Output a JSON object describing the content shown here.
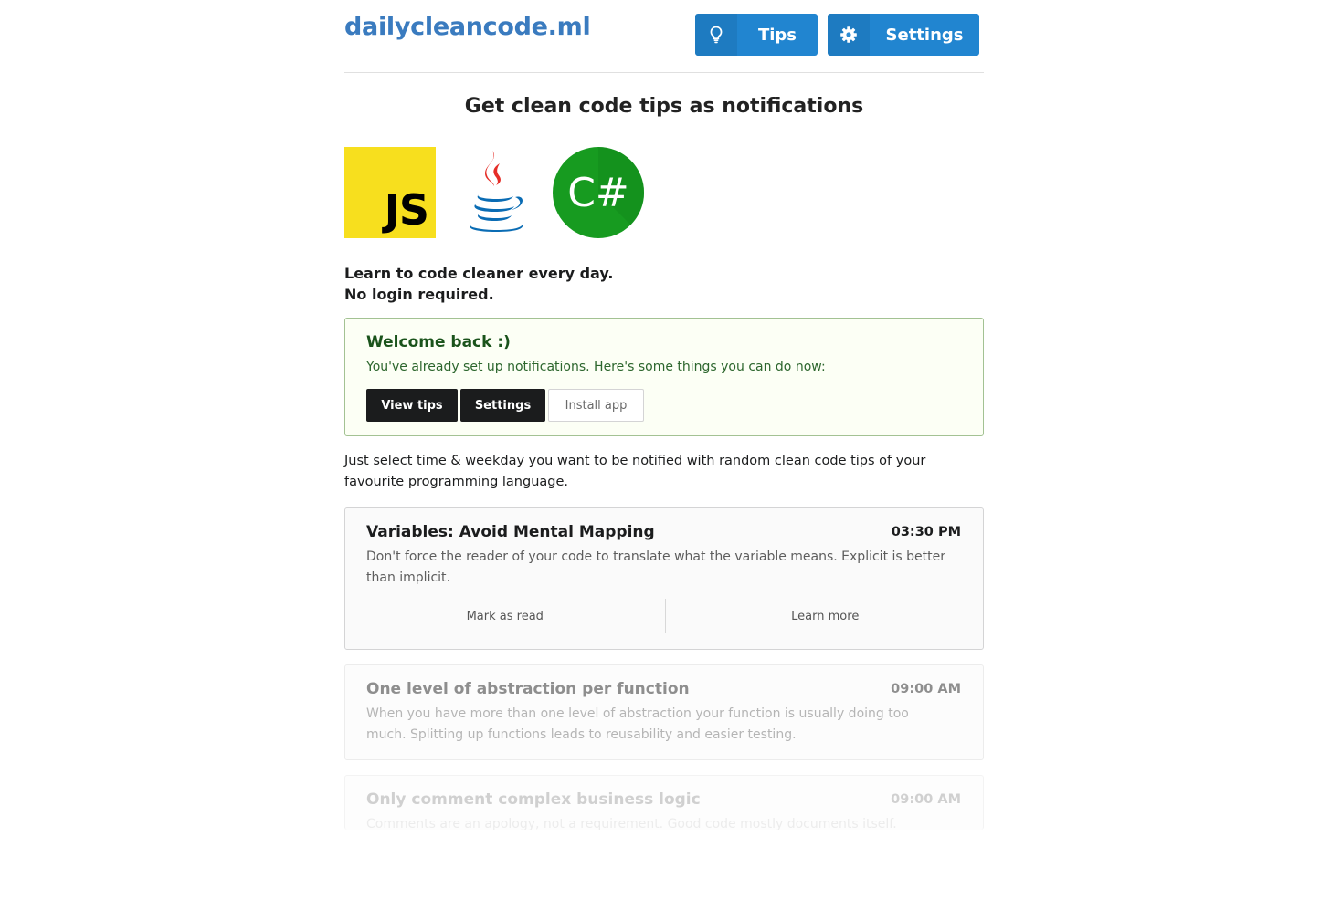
{
  "header": {
    "brand": "dailycleancode.ml",
    "tips_label": "Tips",
    "settings_label": "Settings"
  },
  "headline": "Get clean code tips as notifications",
  "logos": {
    "js_text": "JS",
    "cs_text": "C#"
  },
  "lead": {
    "line1": "Learn to code cleaner every day.",
    "line2": "No login required."
  },
  "welcome": {
    "title": "Welcome back :)",
    "text": "You've already set up notifications. Here's some things you can do now:",
    "view_tips": "View tips",
    "settings": "Settings",
    "install": "Install app"
  },
  "description": "Just select time & weekday you want to be notified with random clean code tips of your favourite programming language.",
  "tips": [
    {
      "title": "Variables: Avoid Mental Mapping",
      "time": "03:30 PM",
      "body": "Don't force the reader of your code to translate what the variable means. Explicit is better than implicit.",
      "mark_read": "Mark as read",
      "learn_more": "Learn more"
    },
    {
      "title": "One level of abstraction per function",
      "time": "09:00 AM",
      "body": "When you have more than one level of abstraction your function is usually doing too much. Splitting up functions leads to reusability and easier testing."
    },
    {
      "title": "Only comment complex business logic",
      "time": "09:00 AM",
      "body": "Comments are an apology, not a requirement. Good code mostly documents itself."
    }
  ],
  "colors": {
    "brand": "#3a7bbf",
    "primary_button": "#2185d0",
    "js_yellow": "#f7df1e",
    "csharp_green": "#179b20"
  }
}
